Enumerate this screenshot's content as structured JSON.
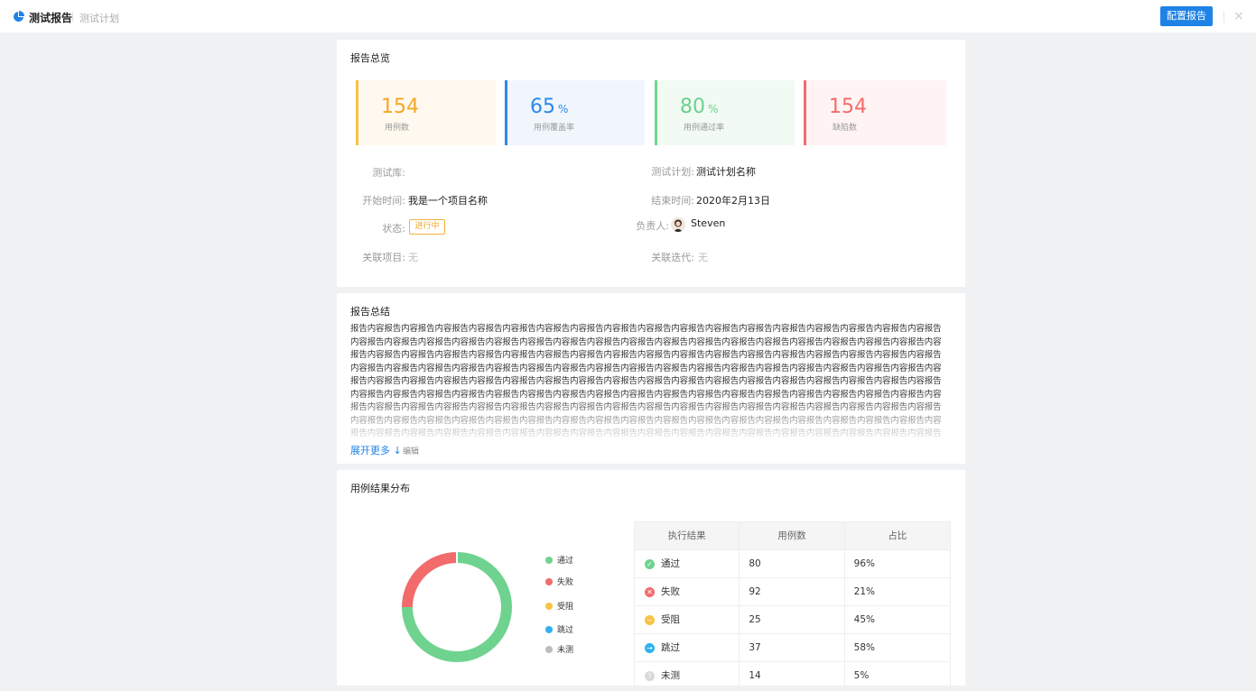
{
  "header": {
    "title": "测试报告",
    "subtitle": "测试计划",
    "config_button": "配置报告",
    "close": "×",
    "brand_color": "#1d83e6"
  },
  "overview": {
    "title": "报告总览",
    "stats": [
      {
        "value": "154",
        "suffix": "",
        "label": "用例数",
        "color": "#f5c342",
        "bg": "#fff9ef",
        "text_color": "#f5a623"
      },
      {
        "value": "65",
        "suffix": "%",
        "label": "用例覆盖率",
        "color": "#2b89e8",
        "bg": "#f1f6fd",
        "text_color": "#2b89e8"
      },
      {
        "value": "80",
        "suffix": "%",
        "label": "用例通过率",
        "color": "#72d490",
        "bg": "#f2faf4",
        "text_color": "#6cd08e"
      },
      {
        "value": "154",
        "suffix": "",
        "label": "缺陷数",
        "color": "#f06d6d",
        "bg": "#fff3f3",
        "text_color": "#f36b6b"
      }
    ],
    "fields": {
      "repo_label": "测试库:",
      "repo_value": "",
      "plan_label": "测试计划:",
      "plan_value": "测试计划名称",
      "start_label": "开始时间:",
      "start_value": "我是一个项目名称",
      "end_label": "结束时间:",
      "end_value": "2020年2月13日",
      "status_label": "状态:",
      "status_value": "进行中",
      "owner_label": "负责人:",
      "owner_value": "Steven",
      "project_label": "关联项目:",
      "project_value": "无",
      "iteration_label": "关联迭代:",
      "iteration_value": "无"
    }
  },
  "summary": {
    "title": "报告总结",
    "content": "报告内容报告内容报告内容报告内容报告内容报告内容报告内容报告内容报告内容报告内容报告内容报告内容报告内容报告内容报告内容报告内容报告内容报告内容报告内容报告内容报告内容报告内容报告内容报告内容报告内容报告内容报告内容报告内容报告内容报告内容报告内容报告内容报告内容报告内容报告内容报告内容报告内容报告内容报告内容报告内容报告内容报告内容报告内容报告内容报告内容报告内容报告内容报告内容报告内容报告内容报告内容报告内容报告内容报告内容报告内容报告内容报告内容报告内容报告内容报告内容报告内容报告内容报告内容报告内容报告内容报告内容报告内容报告内容报告内容报告内容报告内容报告内容报告内容报告内容报告内容报告内容报告内容报告内容报告内容报告内容报告内容报告内容报告内容报告内容报告内容报告内容报告内容报告内容报告内容报告内容报告内容报告内容报告内容报告内容报告内容报告内容报告内容报告内容报告内容报告内容报告内容报告内容报告内容报告内容报告内容报告内容报告内容报告内容报告内容报告内容报告内容报告内容报告内容报告内容报告内容报告内容报告内容报告内容报告内容报告内容报告内容报告内容报告内容报告内容报告内容报告内容报告内容报告内容报告内容报告内容报告内容报告内容报告内容报告内容报告内容报告内容报告内容报告内容报告内容报告内容报告内容报告内容报告内容报告内容报告内容报告内容报告内容报告内容报告内容报告内容报告内容报告内容报告内容报告内容报告内容报告内容报告内容报告内容报告内容报告内容报告内容报告内容报告内容报告内容报告内容报告内容报告内容报告内容报告内容报告内容报告内容报告内容报告内容报告内容报告内容报告内容报告内容报告内容报告内容报告内容报告内容报告内容报告内容报告内容报告内容报告内容报告内容报告内容报告内容报告内容报告内容报告内容报告内容报告内容报告内容报告内容报告内容报告内容报告内容报告内容报告内容报告内容报告内容报告内容报告内容报告内容报告内容报告内容报告内容报告内容报告内容报告内容报告内容报告内容报告内容报告内容报告内容报告内容报告内容报告内容报告内容报告内容报告内容报告内容报告内容报告内容报告内容报告内容报告内容报告内容报告内容报告内容报告内容报告内容",
    "expand": "展开更多 ↓",
    "edit": "编辑"
  },
  "distribution": {
    "title": "用例结果分布",
    "legend": [
      {
        "label": "通过",
        "color": "#6fd38f"
      },
      {
        "label": "失败",
        "color": "#f26b6b"
      },
      {
        "label": "受阻",
        "color": "#f7c443"
      },
      {
        "label": "跳过",
        "color": "#2fb2ee"
      },
      {
        "label": "未测",
        "color": "#bcbcbc"
      }
    ],
    "table": {
      "headers": [
        "执行结果",
        "用例数",
        "占比"
      ],
      "rows": [
        {
          "result": "通过",
          "count": "80",
          "ratio": "96%",
          "icon": "check-icon",
          "color": "#6fd38f"
        },
        {
          "result": "失败",
          "count": "92",
          "ratio": "21%",
          "icon": "cross-icon",
          "color": "#f26b6b"
        },
        {
          "result": "受阻",
          "count": "25",
          "ratio": "45%",
          "icon": "minus-icon",
          "color": "#f7c443"
        },
        {
          "result": "跳过",
          "count": "37",
          "ratio": "58%",
          "icon": "arrow-right-icon",
          "color": "#2fb2ee"
        },
        {
          "result": "未测",
          "count": "14",
          "ratio": "5%",
          "icon": "question-icon",
          "color": "#d9d9d9"
        }
      ]
    }
  },
  "chart_data": {
    "type": "pie",
    "categories": [
      "通过",
      "失败"
    ],
    "values": [
      75,
      25
    ],
    "colors": [
      "#6fd38f",
      "#f26b6b"
    ],
    "title": ""
  }
}
